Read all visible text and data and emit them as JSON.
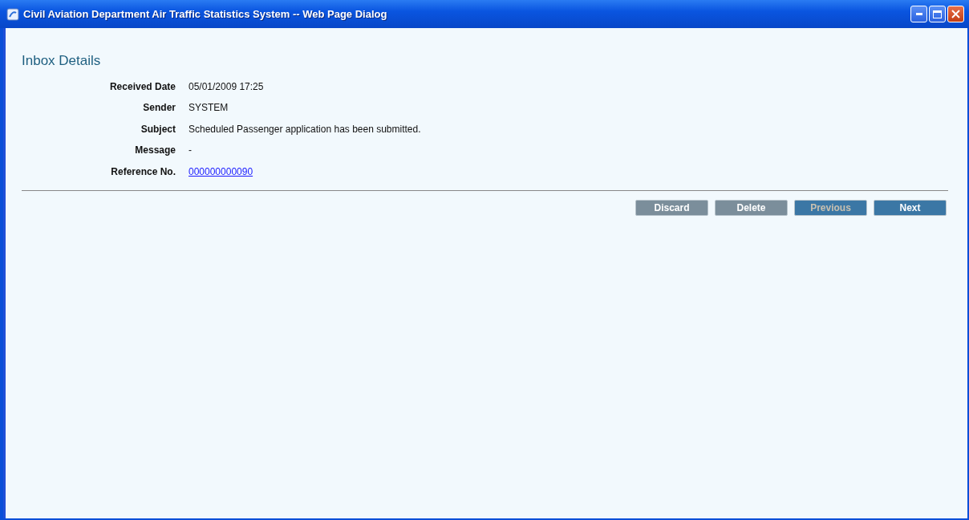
{
  "window": {
    "title": "Civil Aviation Department Air Traffic Statistics System -- Web Page Dialog"
  },
  "heading": "Inbox Details",
  "fields": [
    {
      "label": "Received Date",
      "value": "05/01/2009 17:25",
      "kind": "text"
    },
    {
      "label": "Sender",
      "value": "SYSTEM",
      "kind": "text"
    },
    {
      "label": "Subject",
      "value": "Scheduled Passenger application has been submitted.",
      "kind": "text"
    },
    {
      "label": "Message",
      "value": "-",
      "kind": "text"
    },
    {
      "label": "Reference No.",
      "value": "000000000090",
      "kind": "link"
    }
  ],
  "buttons": [
    {
      "label": "Discard",
      "kind": "secondary",
      "disabled": false
    },
    {
      "label": "Delete",
      "kind": "secondary",
      "disabled": false
    },
    {
      "label": "Previous",
      "kind": "primary",
      "disabled": true
    },
    {
      "label": "Next",
      "kind": "primary",
      "disabled": false
    }
  ]
}
